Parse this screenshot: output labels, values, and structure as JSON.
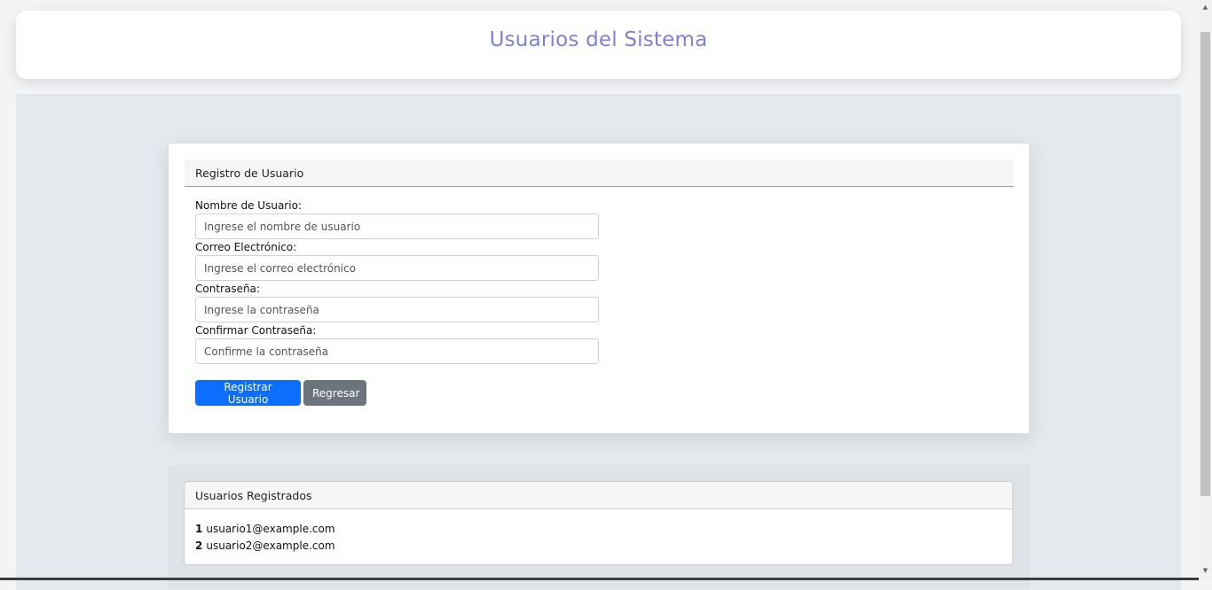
{
  "header": {
    "title": "Usuarios del Sistema"
  },
  "register": {
    "title": "Registro de Usuario",
    "fields": [
      {
        "label": "Nombre de Usuario:",
        "placeholder": "Ingrese el nombre de usuario"
      },
      {
        "label": "Correo Electrónico:",
        "placeholder": "Ingrese el correo electrónico"
      },
      {
        "label": "Contraseña:",
        "placeholder": "Ingrese la contraseña"
      },
      {
        "label": "Confirmar Contraseña:",
        "placeholder": "Confirme la contraseña"
      }
    ],
    "submit_label": "Registrar Usuario",
    "back_label": "Regresar"
  },
  "users": {
    "title": "Usuarios Registrados",
    "items": [
      {
        "id": "1",
        "email": "usuario1@example.com"
      },
      {
        "id": "2",
        "email": "usuario2@example.com"
      }
    ]
  },
  "colors": {
    "title": "#7f7fdc",
    "primary": "#0d6efd",
    "secondary": "#6c757d"
  }
}
